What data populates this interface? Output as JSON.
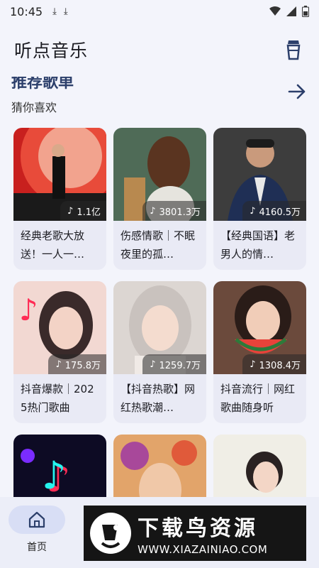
{
  "status_bar": {
    "time": "10:45"
  },
  "app_bar": {
    "title": "听点音乐"
  },
  "section": {
    "title": "推荐歌单",
    "subtitle": "猜你喜欢"
  },
  "playlists": [
    {
      "plays": "1.1亿",
      "title": "经典老歌大放送！一人一…"
    },
    {
      "plays": "3801.3万",
      "title": "伤感情歌｜不眠夜里的孤…"
    },
    {
      "plays": "4160.5万",
      "title": "【经典国语】老男人的情…"
    },
    {
      "plays": "175.8万",
      "title": "抖音爆款｜2025热门歌曲"
    },
    {
      "plays": "1259.7万",
      "title": "【抖音热歌】网红热歌潮…"
    },
    {
      "plays": "1308.4万",
      "title": "抖音流行｜网红歌曲随身听"
    },
    {
      "plays": "",
      "title": ""
    },
    {
      "plays": "",
      "title": ""
    },
    {
      "plays": "",
      "title": ""
    }
  ],
  "bottom_nav": {
    "home_label": "首页"
  },
  "watermark": {
    "name": "下载鸟资源",
    "url": "WWW.XIAZAINIAO.COM"
  }
}
